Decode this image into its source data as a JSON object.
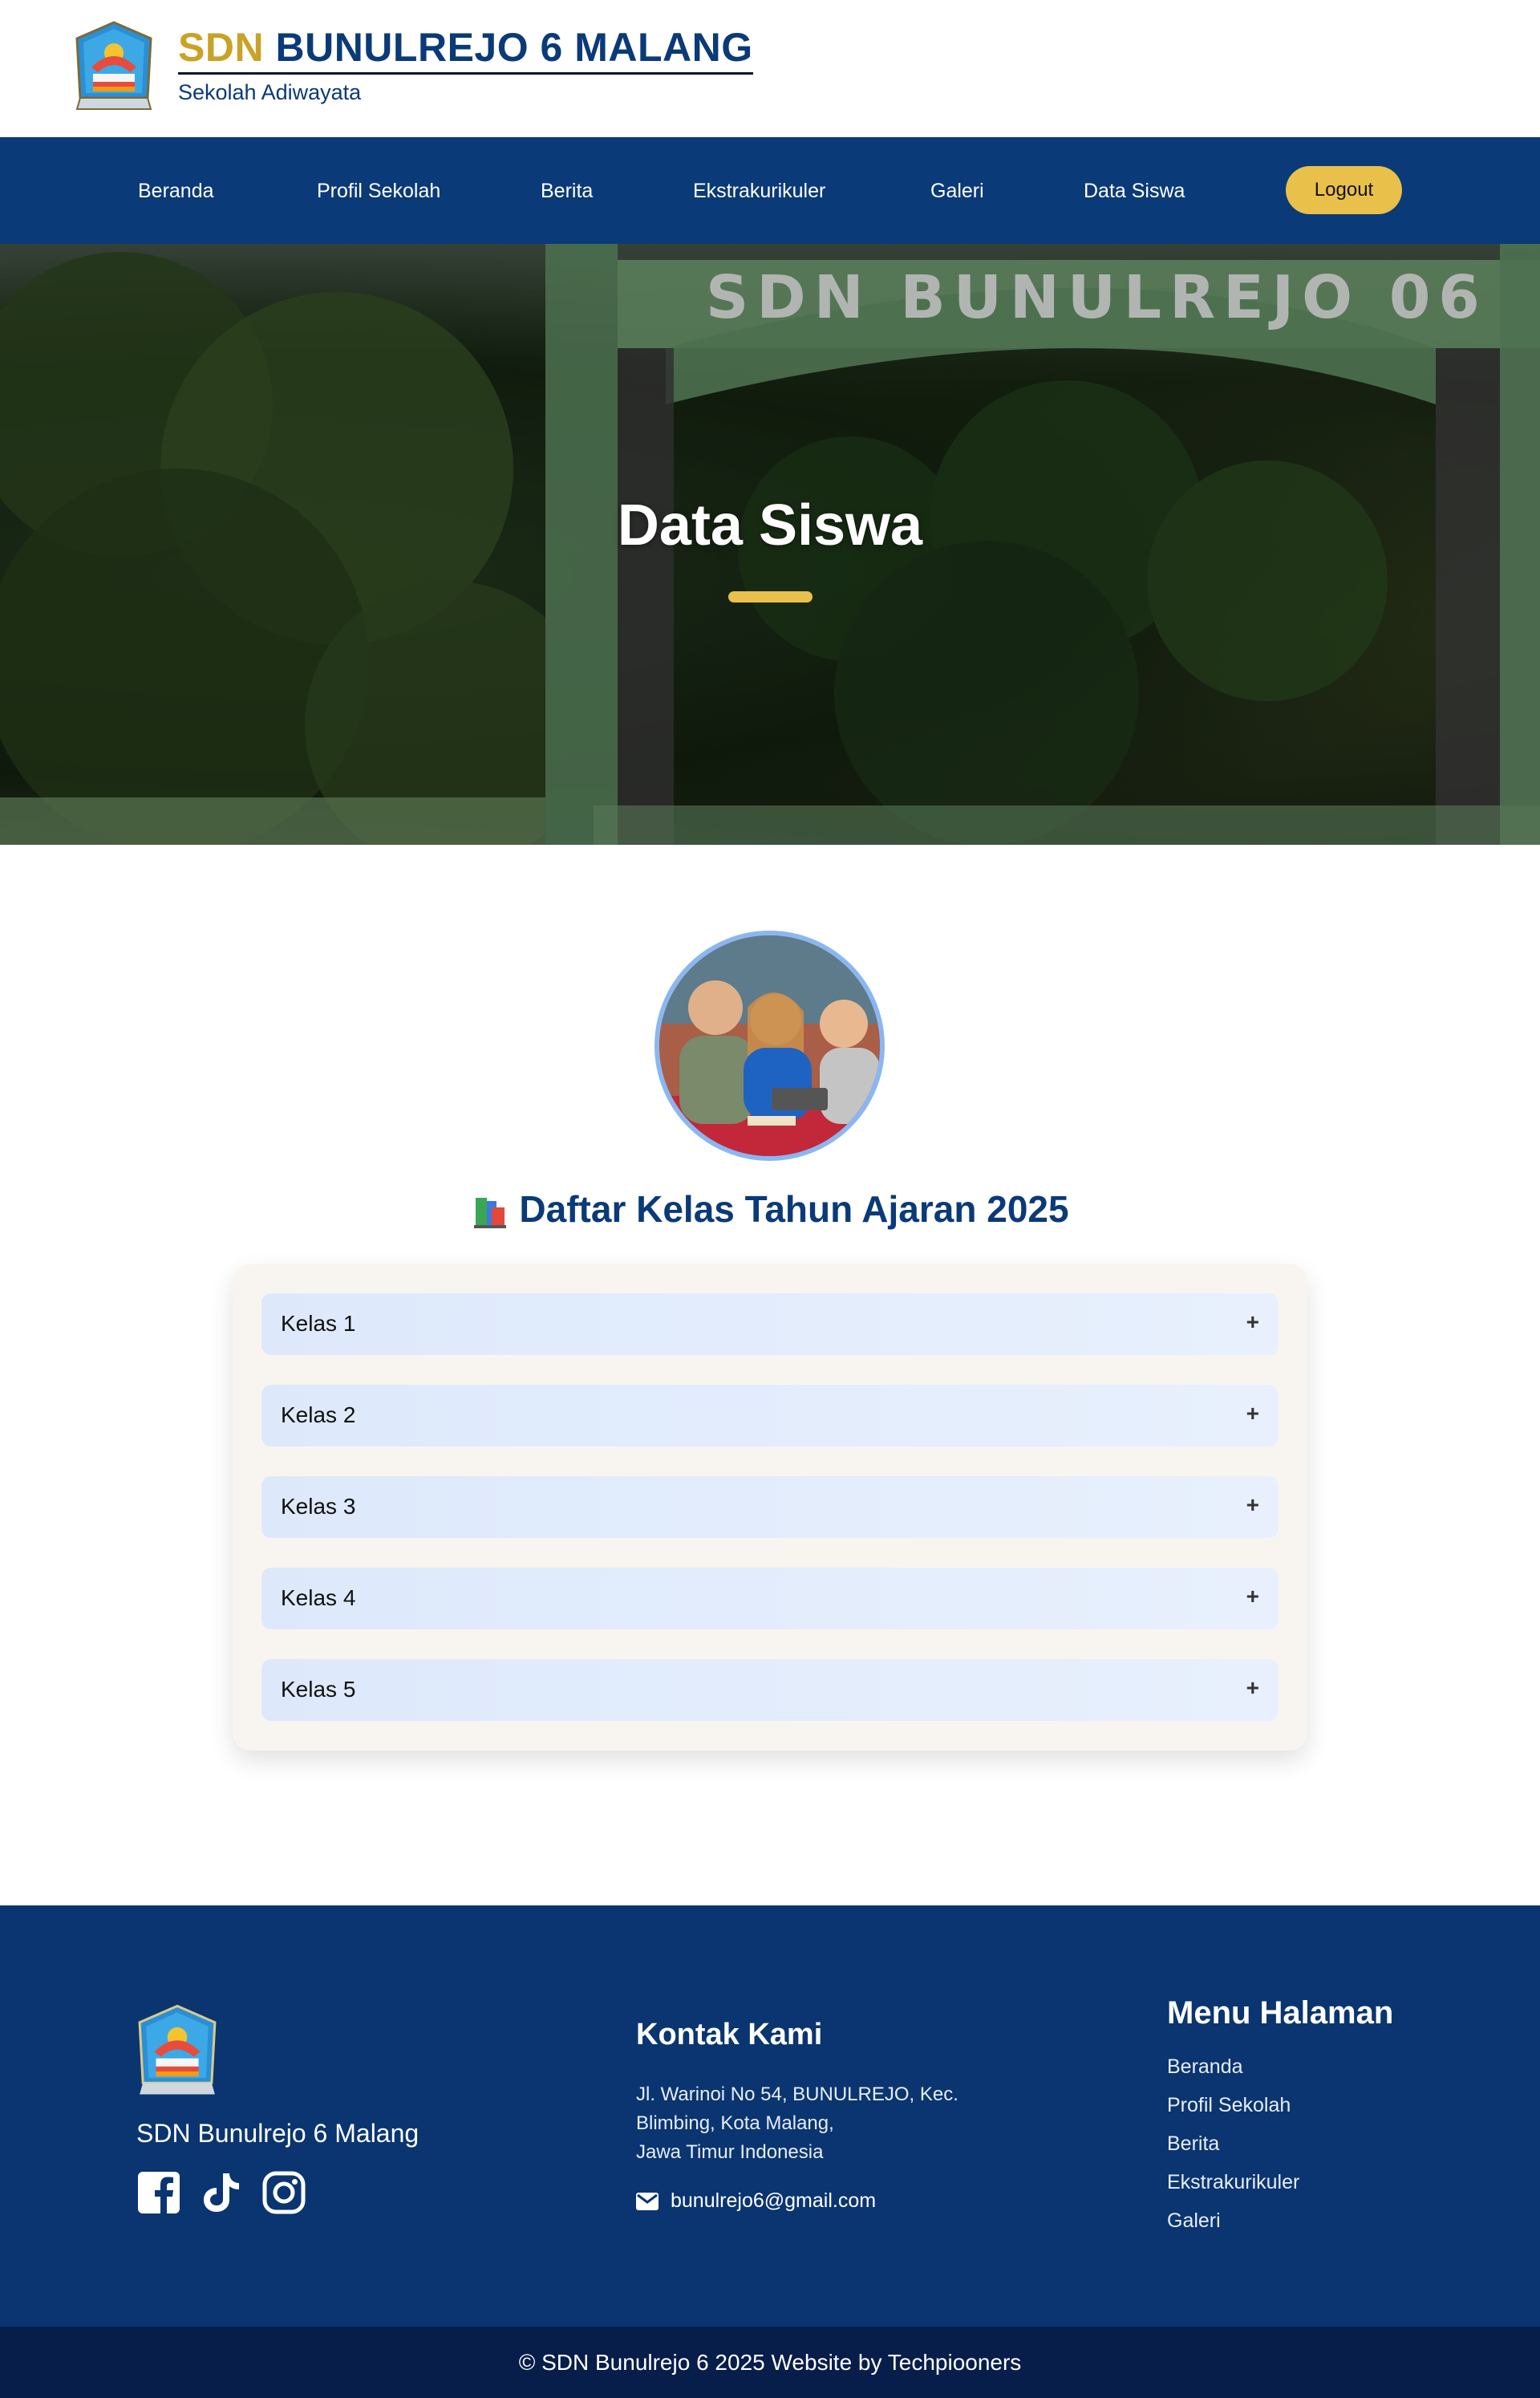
{
  "header": {
    "brand_accent": "SDN",
    "brand_main": "BUNULREJO 6 MALANG",
    "subtitle": "Sekolah Adiwayata"
  },
  "nav": {
    "items": [
      "Beranda",
      "Profil Sekolah",
      "Berita",
      "Ekstrakurikuler",
      "Galeri",
      "Data Siswa"
    ],
    "logout_label": "Logout"
  },
  "hero": {
    "title": "Data Siswa",
    "sign_text": "SDN BUNULREJO 06"
  },
  "main": {
    "section_title": "Daftar Kelas Tahun Ajaran 2025",
    "classes": [
      "Kelas 1",
      "Kelas 2",
      "Kelas 3",
      "Kelas 4",
      "Kelas 5"
    ],
    "expand_symbol": "+"
  },
  "footer": {
    "school_name": "SDN Bunulrejo 6 Malang",
    "social_icons": [
      "facebook-icon",
      "tiktok-icon",
      "instagram-icon"
    ],
    "contact_title": "Kontak Kami",
    "address_lines": [
      "Jl. Warinoi No 54, BUNULREJO, Kec.",
      "Blimbing, Kota Malang,",
      "Jawa Timur Indonesia"
    ],
    "email": "bunulrejo6@gmail.com",
    "menu_title": "Menu Halaman",
    "menu_items": [
      "Beranda",
      "Profil Sekolah",
      "Berita",
      "Ekstrakurikuler",
      "Galeri"
    ]
  },
  "copyright": "© SDN Bunulrejo 6 2025 Website by Techpiooners",
  "colors": {
    "primary": "#0a3a78",
    "accent": "#e9c04a",
    "gold_text": "#c9a227",
    "accordion_item": "#dde9fb"
  }
}
